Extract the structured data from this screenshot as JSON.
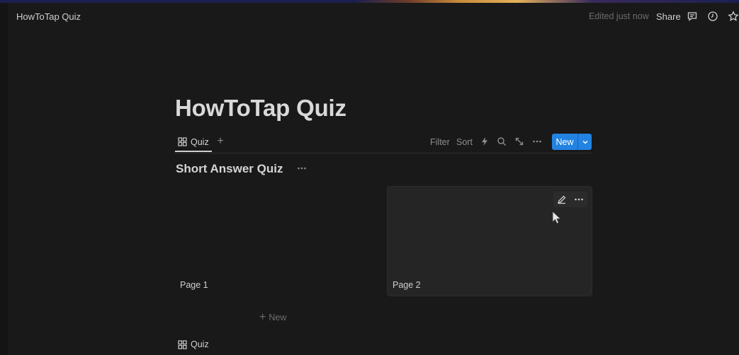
{
  "topbar": {
    "workspace_title": "HowToTap Quiz",
    "edited_status": "Edited just now",
    "share_label": "Share",
    "icons": [
      "comment-icon",
      "clock-icon",
      "star-icon"
    ]
  },
  "page": {
    "title": "HowToTap Quiz"
  },
  "view_bar": {
    "active_tab": "Quiz",
    "add_view_glyph": "+",
    "filter_label": "Filter",
    "sort_label": "Sort",
    "icons": [
      "lightning-icon",
      "search-icon",
      "expand-icon",
      "more-icon"
    ],
    "new_button_label": "New",
    "accent_color": "#2383e2"
  },
  "section": {
    "title": "Short Answer Quiz"
  },
  "cards": [
    {
      "name": "Page 1"
    },
    {
      "name": "Page 2"
    }
  ],
  "new_row_label": "New",
  "bottom_tab_label": "Quiz"
}
